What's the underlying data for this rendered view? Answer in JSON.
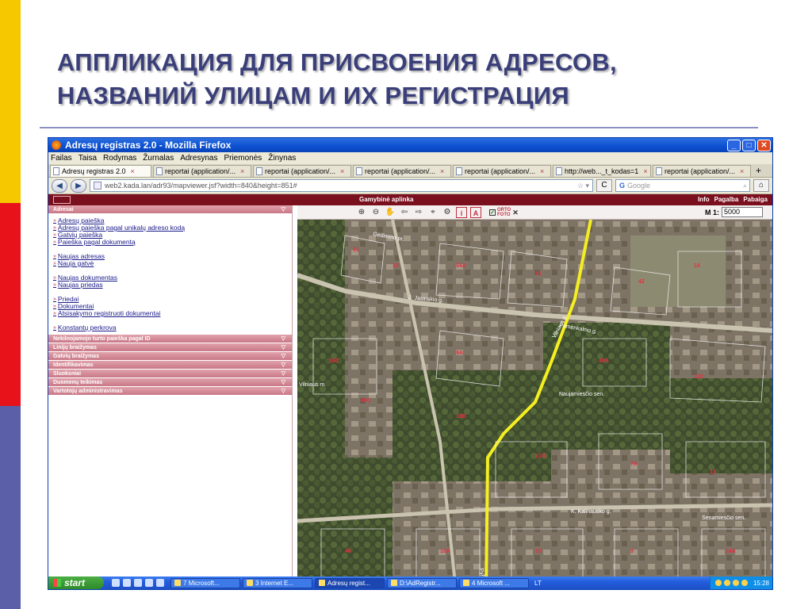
{
  "slide": {
    "title_line1": "АППЛИКАЦИЯ ДЛЯ ПРИСВОЕНИЯ АДРЕСОВ,",
    "title_line2": "НАЗВАНИЙ УЛИЦАМ И ИХ РЕГИСТРАЦИЯ"
  },
  "window": {
    "title": "Adresų registras 2.0 - Mozilla Firefox",
    "min": "_",
    "max": "□",
    "close": "✕"
  },
  "menu": [
    "Failas",
    "Taisa",
    "Rodymas",
    "Žurnalas",
    "Adresynas",
    "Priemonės",
    "Žinynas"
  ],
  "tabs": [
    {
      "label": "Adresų registras 2.0",
      "active": true
    },
    {
      "label": "reportai (application/...",
      "active": false
    },
    {
      "label": "reportai (application/...",
      "active": false
    },
    {
      "label": "reportai (application/...",
      "active": false
    },
    {
      "label": "reportai (application/...",
      "active": false
    },
    {
      "label": "http://web..._t_kodas=1",
      "active": false
    },
    {
      "label": "reportai (application/...",
      "active": false
    }
  ],
  "tab_close": "×",
  "tab_new": "+",
  "nav": {
    "back": "◀",
    "forward": "▶",
    "url": "web2.kada.lan/adr93/mapviewer.jsf?width=840&height=851#",
    "star": "☆ ▾",
    "reload": "C",
    "search_placeholder": "Google",
    "search_engine": "G",
    "search_btn": "⌕",
    "home": "⌂"
  },
  "app": {
    "header_center": "Gamybinė aplinka",
    "header_links": [
      "Info",
      "Pagalba",
      "Pabaiga"
    ],
    "section_open": "Adresai",
    "link_groups": [
      [
        "Adresų paieška",
        "Adresų paieška pagal unikalų adreso kodą",
        "Gatvių paieška",
        "Paieška pagal dokumentą"
      ],
      [
        "Naujas adresas",
        "Nauja gatvė"
      ],
      [
        "Naujas dokumentas",
        "Naujas priedas"
      ],
      [
        "Priedai",
        "Dokumentai",
        "Atsisakymo registruoti dokumentai"
      ],
      [
        "Konstantų perkrova"
      ]
    ],
    "sections_collapsed": [
      "Nekilnojamojo turto paieška pagal ID",
      "Linijų braižymas",
      "Gatvių braižymas",
      "Identifikavimas",
      "Sluoksniai",
      "Duomenų teikimas",
      "Vartotojų administravimas"
    ],
    "chevron": "▽",
    "link_arrow": "»"
  },
  "map": {
    "tools": [
      "⊕",
      "⊖",
      "✋",
      "⇦",
      "⇨",
      "⌖",
      "⚙"
    ],
    "info_btn": "i",
    "area_btn": "A",
    "ortho_check": "✓",
    "ortho_line1": "ORTO",
    "ortho_line2": "FOTO",
    "ortho_x": "✕",
    "scale_label": "M 1:",
    "scale_value": "5000",
    "labels": [
      {
        "t": "Gedimino pr."
      },
      {
        "t": "J. Jasinskio g."
      },
      {
        "t": "Pamėnkalnio g."
      },
      {
        "t": "Vilniaus m."
      },
      {
        "t": "Naujamiesčio sen."
      },
      {
        "t": "K. Kalinausko g."
      },
      {
        "t": "Senamiesčio sen."
      },
      {
        "t": "Vilniaus g."
      },
      {
        "t": "Pylimo g."
      }
    ]
  },
  "taskbar": {
    "start": "start",
    "tasks": [
      {
        "label": "7 Microsoft...",
        "active": false
      },
      {
        "label": "3 Internet E...",
        "active": false
      },
      {
        "label": "Adresų regist...",
        "active": true
      },
      {
        "label": "D:\\AdRegistr...",
        "active": false
      },
      {
        "label": "4 Microsoft ...",
        "active": false
      }
    ],
    "lang": "LT",
    "clock": "15:28"
  }
}
